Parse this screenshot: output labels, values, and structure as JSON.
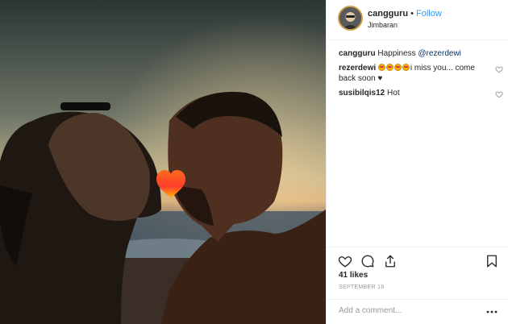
{
  "post": {
    "username": "cangguru",
    "follow_label": "Follow",
    "separator": "•",
    "location": "Jimbaran"
  },
  "caption": {
    "username": "cangguru",
    "text": "Happiness",
    "mention": "@rezerdewi"
  },
  "comments": [
    {
      "username": "rezerdewi",
      "text": "i miss you... come back soon ♥",
      "emoji_count": 4
    },
    {
      "username": "susibilqis12",
      "text": "Hot"
    }
  ],
  "likes": "41 likes",
  "date": "September 16",
  "add_comment": {
    "placeholder": "Add a comment..."
  },
  "colors": {
    "follow": "#3897f0",
    "border": "#efefef",
    "muted": "#999999",
    "text": "#262626"
  },
  "icons": [
    "heart-icon",
    "comment-icon",
    "share-icon",
    "bookmark-icon",
    "more-icon"
  ]
}
